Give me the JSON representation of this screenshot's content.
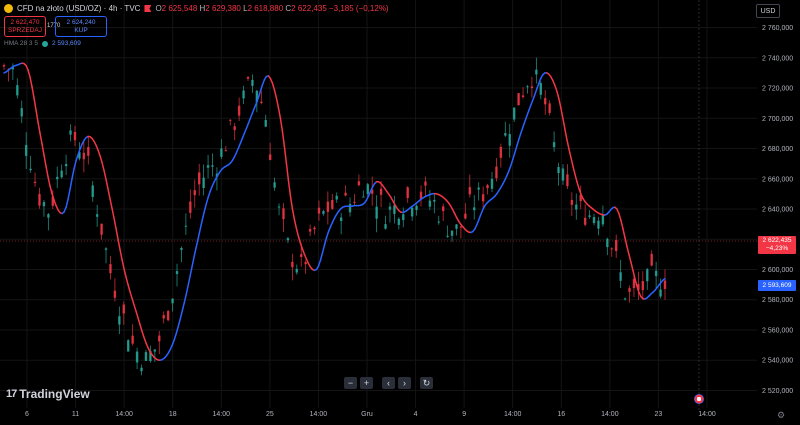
{
  "header": {
    "title": "CFD na złoto (USD/OZ) · 4h · TVC",
    "ohlc": {
      "o_label": "O",
      "o": "2 625,548",
      "h_label": "H",
      "h": "2 629,380",
      "l_label": "L",
      "l": "2 618,880",
      "c_label": "C",
      "c": "2 622,435",
      "change": "−3,185 (−0,12%)"
    }
  },
  "trade": {
    "sell_price": "2 622,470",
    "sell_label": "SPRZEDAJ",
    "spread": "1770",
    "buy_price": "2 624,240",
    "buy_label": "KUP"
  },
  "indicator": {
    "name": "HMA 28 3 5",
    "value": "2 593,609"
  },
  "currency": "USD",
  "price_label": {
    "price": "2 622,435",
    "change": "−4,23%"
  },
  "hma_label": "2 593,609",
  "nav": {
    "minus": "−",
    "plus": "+",
    "left": "‹",
    "right": "›",
    "reset": "↻"
  },
  "brand": "TradingView",
  "colors": {
    "up": "#26a69a",
    "down": "#f23645",
    "hma_up": "#2962ff",
    "hma_down": "#f23645",
    "bg": "#000000",
    "grid": "#141414",
    "axis_text": "#b2b5be"
  },
  "chart_data": {
    "type": "line",
    "y_axis_ticks": [
      "2 760,000",
      "2 740,000",
      "2 720,000",
      "2 700,000",
      "2 680,000",
      "2 660,000",
      "2 640,000",
      "2 620,000",
      "2 600,000",
      "2 580,000",
      "2 560,000",
      "2 540,000",
      "2 520,000"
    ],
    "ylim": [
      2515,
      2765
    ],
    "x_tick_labels": [
      "6",
      "11",
      "14:00",
      "18",
      "14:00",
      "25",
      "14:00",
      "Gru",
      "4",
      "9",
      "14:00",
      "16",
      "14:00",
      "23",
      "14:00"
    ],
    "current_price": 2622.435,
    "series": [
      {
        "name": "HMA 28 3 5",
        "values": [
          2730,
          2735,
          2732,
          2690,
          2650,
          2638,
          2672,
          2688,
          2675,
          2640,
          2600,
          2572,
          2548,
          2540,
          2550,
          2578,
          2615,
          2648,
          2665,
          2672,
          2690,
          2710,
          2728,
          2700,
          2640,
          2610,
          2600,
          2625,
          2640,
          2642,
          2644,
          2658,
          2650,
          2638,
          2642,
          2648,
          2650,
          2644,
          2630,
          2625,
          2642,
          2650,
          2665,
          2690,
          2712,
          2730,
          2718,
          2680,
          2650,
          2640,
          2636,
          2640,
          2610,
          2582,
          2585,
          2594
        ]
      }
    ]
  }
}
